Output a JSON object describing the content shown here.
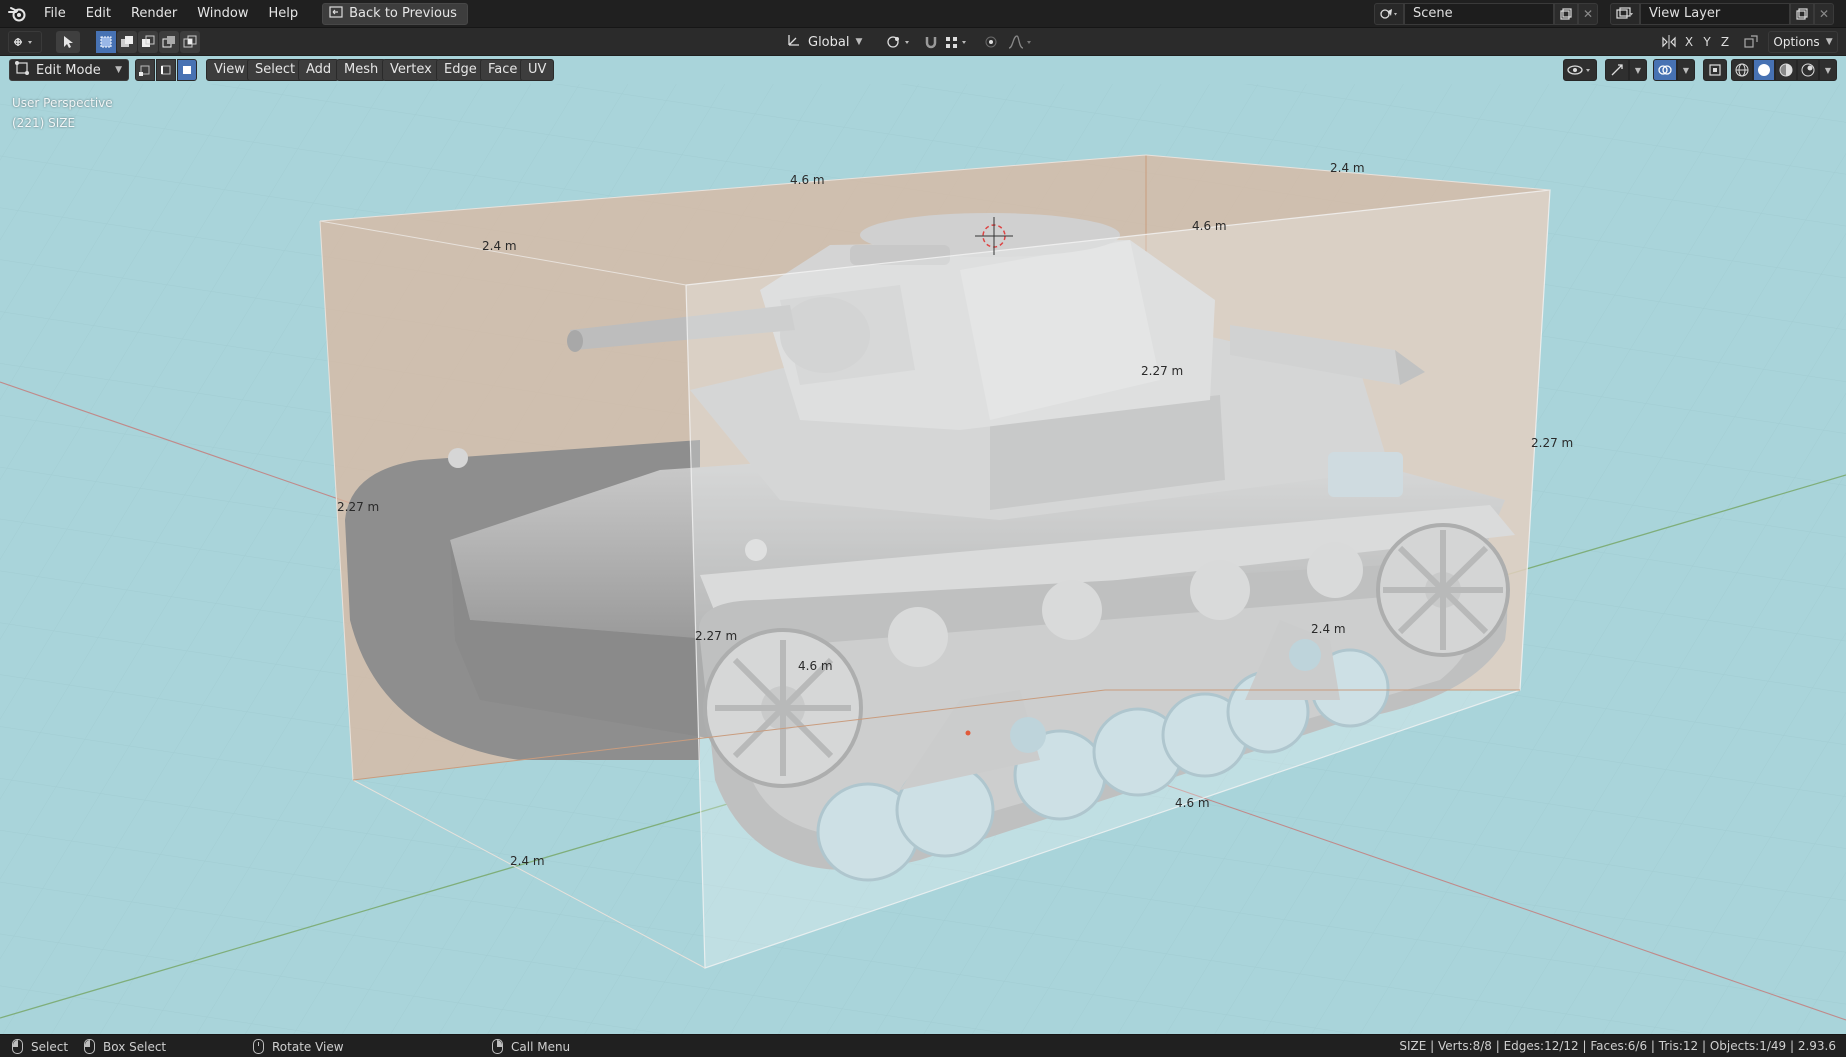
{
  "topbar": {
    "menus": [
      "File",
      "Edit",
      "Render",
      "Window",
      "Help"
    ],
    "back_button": "Back to Previous",
    "scene": "Scene",
    "view_layer": "View Layer"
  },
  "toolbar": {
    "transform_orientation": "Global",
    "axis_labels": [
      "X",
      "Y",
      "Z"
    ],
    "options_label": "Options"
  },
  "viewport_header": {
    "mode": "Edit Mode",
    "menus": [
      "View",
      "Select",
      "Add",
      "Mesh",
      "Vertex",
      "Edge",
      "Face",
      "UV"
    ]
  },
  "viewport": {
    "perspective": "User Perspective",
    "object_info": "(221) SIZE",
    "dimension_labels": [
      "4.6 m",
      "2.4 m",
      "2.4 m",
      "4.6 m",
      "2.27 m",
      "2.27 m",
      "2.27 m",
      "2.27 m",
      "4.6 m",
      "2.4 m",
      "4.6 m",
      "2.4 m"
    ]
  },
  "statusbar": {
    "select": "Select",
    "box_select": "Box Select",
    "rotate_view": "Rotate View",
    "call_menu": "Call Menu",
    "stats": "SIZE | Verts:8/8 | Edges:12/12 | Faces:6/6 | Tris:12 | Objects:1/49 | 2.93.6"
  },
  "colors": {
    "viewport_bg": "#a9d4da",
    "header_bg": "#202020",
    "selection_blue": "#4772b3",
    "bbox_fill": "#d9b8a3"
  }
}
